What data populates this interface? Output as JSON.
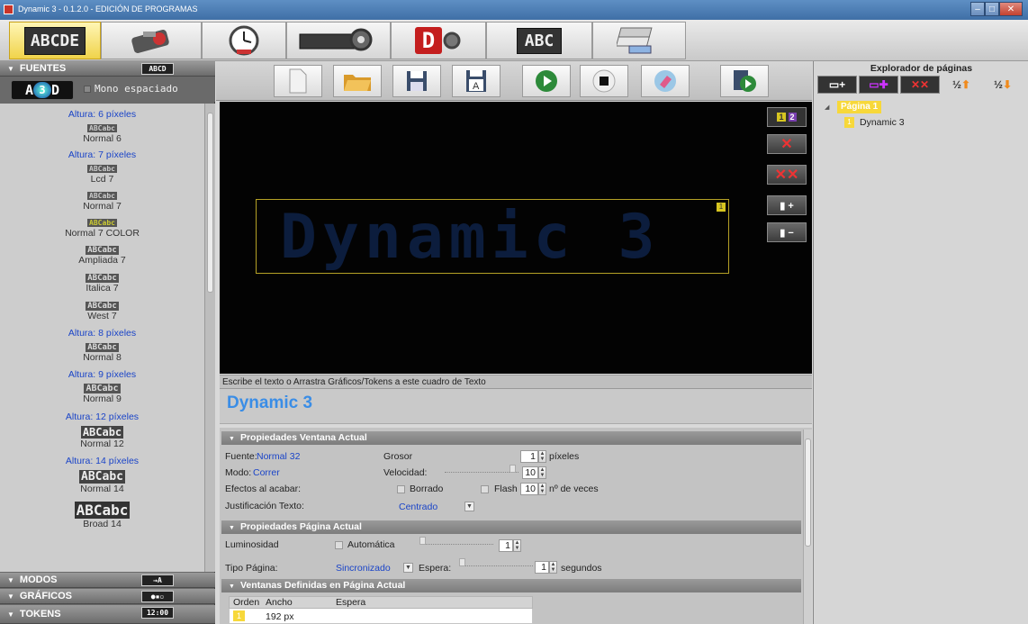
{
  "window": {
    "title": "Dynamic 3 - 0.1.2.0 - EDICIÓN DE PROGRAMAS"
  },
  "tabs": [
    {
      "name": "tab-text",
      "icon": "led-text-icon",
      "label": "ABCDE",
      "active": true
    },
    {
      "name": "tab-graphics",
      "icon": "graphics-tool-icon",
      "label": "",
      "active": false
    },
    {
      "name": "tab-clock",
      "icon": "clock-icon",
      "label": "",
      "active": false
    },
    {
      "name": "tab-settings",
      "icon": "gear-led-icon",
      "label": "",
      "active": false
    },
    {
      "name": "tab-dynamic",
      "icon": "dynamic-logo-icon",
      "label": "D",
      "active": false
    },
    {
      "name": "tab-font-editor",
      "icon": "font-editor-icon",
      "label": "ABC",
      "active": false
    },
    {
      "name": "tab-transfer",
      "icon": "transfer-device-icon",
      "label": "",
      "active": false
    }
  ],
  "left": {
    "fonts_header": "FUENTES",
    "fonts_badge": "ABCD",
    "mono_logo": "A3D",
    "mono_label": "Mono espaciado",
    "font_items": [
      {
        "kind": "group",
        "text": "Altura: 6 píxeles"
      },
      {
        "kind": "font",
        "sample": "ABCabc",
        "name": "Normal 6"
      },
      {
        "kind": "group",
        "text": "Altura: 7 píxeles"
      },
      {
        "kind": "font",
        "sample": "ABCabc",
        "name": "Lcd 7"
      },
      {
        "kind": "font",
        "sample": "ABCabc",
        "name": "Normal 7"
      },
      {
        "kind": "font",
        "sample": "ABCabc",
        "name": "Normal 7 COLOR"
      },
      {
        "kind": "font",
        "sample": "ABCabc",
        "name": "Ampliada 7"
      },
      {
        "kind": "font",
        "sample": "ABCabc",
        "name": "Italica 7"
      },
      {
        "kind": "font",
        "sample": "ABCabc",
        "name": "West 7"
      },
      {
        "kind": "group",
        "text": "Altura: 8 píxeles"
      },
      {
        "kind": "font",
        "sample": "ABCabc",
        "name": "Normal 8"
      },
      {
        "kind": "group",
        "text": "Altura: 9 píxeles"
      },
      {
        "kind": "font",
        "sample": "ABCabc",
        "name": "Normal 9"
      },
      {
        "kind": "group",
        "text": "Altura: 12 píxeles"
      },
      {
        "kind": "font",
        "sample": "ABCabc",
        "name": "Normal 12"
      },
      {
        "kind": "group",
        "text": "Altura: 14 píxeles"
      },
      {
        "kind": "font",
        "sample": "ABCabc",
        "name": "Normal 14"
      },
      {
        "kind": "font",
        "sample": "ABCabc",
        "name": "Broad 14"
      }
    ],
    "modes_header": "MODOS",
    "graphics_header": "GRÁFICOS",
    "tokens_header": "TOKENS"
  },
  "toolbar": [
    {
      "name": "new-file-button",
      "icon": "new-file-icon"
    },
    {
      "name": "open-button",
      "icon": "folder-icon"
    },
    {
      "name": "save-button",
      "icon": "floppy-icon"
    },
    {
      "name": "save-as-button",
      "icon": "floppy-a-icon"
    },
    {
      "name": "play-button",
      "icon": "play-icon"
    },
    {
      "name": "stop-button",
      "icon": "stop-icon"
    },
    {
      "name": "clear-button",
      "icon": "eraser-icon"
    },
    {
      "name": "preview-button",
      "icon": "preview-play-icon"
    }
  ],
  "canvas": {
    "display_text": "Dynamic 3",
    "window_number": "1",
    "side_buttons": [
      "page-toggle-icon",
      "delete-window-icon",
      "delete-all-windows-icon",
      "add-window-icon",
      "remove-window-icon"
    ],
    "page_badge_1": "1",
    "page_badge_2": "2"
  },
  "hint": "Escribe el texto o Arrastra Gráficos/Tokens a este cuadro de Texto",
  "text_value": "Dynamic 3",
  "window_props": {
    "header": "Propiedades Ventana Actual",
    "font_label": "Fuente:",
    "font_value": "Normal 32",
    "mode_label": "Modo:",
    "mode_value": "Correr",
    "effects_label": "Efectos al acabar:",
    "justify_label": "Justificación Texto:",
    "justify_value": "Centrado",
    "thickness_label": "Grosor",
    "thickness_value": "1",
    "thickness_unit": "píxeles",
    "speed_label": "Velocidad:",
    "speed_value": "10",
    "erase_label": "Borrado",
    "flash_label": "Flash",
    "flash_value": "10",
    "flash_unit": "nº de veces"
  },
  "page_props": {
    "header": "Propiedades Página Actual",
    "brightness_label": "Luminosidad",
    "auto_label": "Automática",
    "brightness_value": "1",
    "type_label": "Tipo Página:",
    "type_value": "Sincronizado",
    "wait_label": "Espera:",
    "wait_value": "1",
    "wait_unit": "segundos"
  },
  "windows_table": {
    "header": "Ventanas Definidas en Página Actual",
    "columns": [
      "Orden",
      "Ancho",
      "Espera"
    ],
    "rows": [
      {
        "order": "1",
        "width": "192 px",
        "wait": ""
      }
    ]
  },
  "explorer": {
    "title": "Explorador de páginas",
    "tools": [
      "add-page-icon",
      "add-page-alt-icon",
      "delete-page-icon",
      "move-page-up-icon",
      "move-page-down-icon"
    ],
    "page_label": "Página 1",
    "window_label": "Dynamic 3",
    "window_number": "1"
  },
  "colors": {
    "accent_yellow": "#f7d83a",
    "led_blue": "#0c1d3d",
    "link_blue": "#1a44c8"
  }
}
